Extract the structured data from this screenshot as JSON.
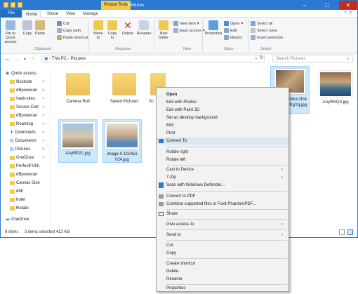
{
  "window": {
    "title": "Pictures",
    "context_tab": "Picture Tools",
    "tabs": [
      "File",
      "Home",
      "Share",
      "View",
      "Manage"
    ]
  },
  "ribbon": {
    "pin_quick_access": "Pin to Quick access",
    "copy": "Copy",
    "paste": "Paste",
    "cut": "Cut",
    "copy_path": "Copy path",
    "paste_shortcut": "Paste shortcut",
    "move_to": "Move to",
    "copy_to": "Copy to",
    "delete": "Delete",
    "rename": "Rename",
    "new_folder": "New folder",
    "new_item": "New item",
    "easy_access": "Easy access",
    "properties": "Properties",
    "open": "Open",
    "edit": "Edit",
    "history": "History",
    "select_all": "Select all",
    "select_none": "Select none",
    "invert_selection": "Invert selection",
    "groups": [
      "Clipboard",
      "Organise",
      "New",
      "Open",
      "Select"
    ]
  },
  "address": {
    "path": "This PC  ›  Pictures",
    "search_placeholder": "Search Pictures"
  },
  "nav": {
    "items": [
      {
        "label": "Quick access"
      },
      {
        "label": "Illustrate"
      },
      {
        "label": "dBpoweran"
      },
      {
        "label": "!web-sites"
      },
      {
        "label": "Source Cod"
      },
      {
        "label": "dBpoweran"
      },
      {
        "label": "Roaming"
      },
      {
        "label": "Downloads"
      },
      {
        "label": "Documents"
      },
      {
        "label": "Pictures"
      },
      {
        "label": "OneDrive"
      },
      {
        "label": "PerfectFUNI"
      },
      {
        "label": "dBpoweran"
      },
      {
        "label": "Canvas Size"
      },
      {
        "label": "dMI"
      },
      {
        "label": "hotel"
      },
      {
        "label": "Rotate"
      },
      {
        "label": "OneDrive"
      }
    ]
  },
  "files": [
    {
      "label": "Camera Roll"
    },
    {
      "label": "Saved Pictures"
    },
    {
      "label": "Sc"
    },
    {
      "label": "vzNtcn2fn4\nyKgYg.jpg"
    },
    {
      "label": "AAyRNQ3.jpg"
    },
    {
      "label": "AAyRPZc.jpg"
    },
    {
      "label": "image-0-1024x1\n024.jpg"
    }
  ],
  "status": {
    "count": "9 items",
    "selected": "3 items selected  413 KB"
  },
  "context_menu": {
    "items": [
      "Open",
      "Edit with Photos",
      "Edit with Paint 3D",
      "Set as desktop background",
      "Edit",
      "Print",
      "Convert To",
      "Rotate right",
      "Rotate left",
      "Cast to Device",
      "7-Zip",
      "Scan with Windows Defender...",
      "Convert to PDF",
      "Combine supported files in Foxit PhantomPDF...",
      "Share",
      "Give access to",
      "Send to",
      "Cut",
      "Copy",
      "Create shortcut",
      "Delete",
      "Rename",
      "Properties"
    ]
  },
  "colors": {
    "title_bar": "#2b79d0",
    "context_tab": "#f3c94c",
    "selection": "#cce8ff",
    "menu_highlight": "#dbe6f4"
  }
}
